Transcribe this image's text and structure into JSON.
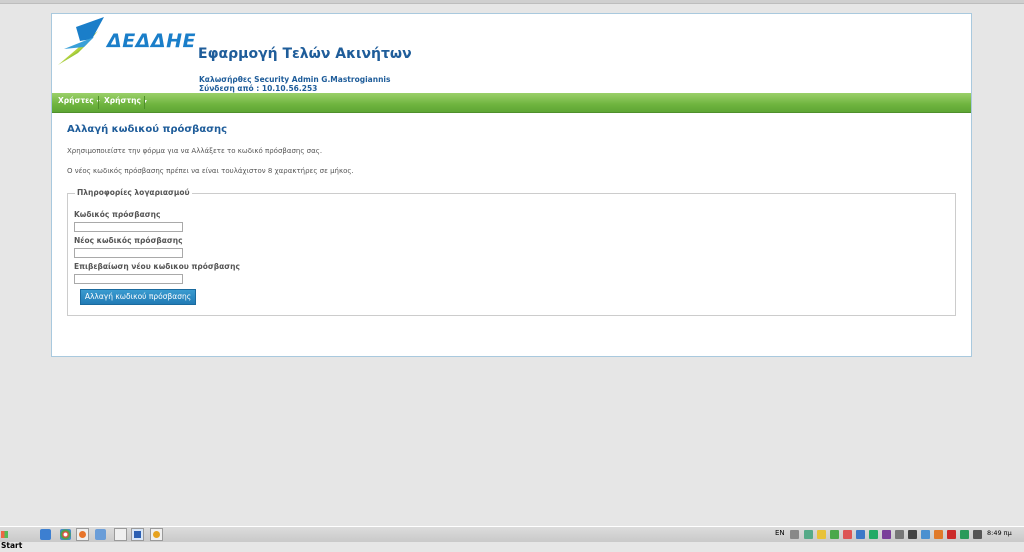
{
  "logo": {
    "text": "ΔΕΔΔΗΕ"
  },
  "header": {
    "app_title": "Εφαρμογή Τελών Ακινήτων",
    "welcome": "Καλωσήρθες Security Admin G.Mastrogiannis",
    "connection": "Σύνδεση από : 10.10.56.253"
  },
  "menu": {
    "items": [
      {
        "label": "Χρήστες",
        "icon": "caret-down-icon"
      },
      {
        "label": "Χρήστης",
        "icon": "caret-down-icon"
      }
    ]
  },
  "form": {
    "heading": "Αλλαγή κωδικού πρόσβασης",
    "info1": "Χρησιμοποιείστε την φόρμα για να Αλλάξετε το κωδικό πρόσβασης σας.",
    "info2": "Ο νέος κωδικός πρόσβασης πρέπει να είναι τουλάχιστον 8 χαρακτήρες σε μήκος.",
    "legend": "Πληροφορίες λογαριασμού",
    "fields": [
      {
        "label": "Κωδικός πρόσβασης",
        "value": ""
      },
      {
        "label": "Νέος κωδικός πρόσβασης",
        "value": ""
      },
      {
        "label": "Επιβεβαίωση νέου κωδικου πρόσβασης",
        "value": ""
      }
    ],
    "submit_label": "Αλλαγή κωδικού πρόσβασης"
  },
  "taskbar": {
    "start_label": "Start",
    "language": "EN",
    "clock": "8:49 πμ"
  },
  "colors": {
    "accent": "#1f5d9a",
    "menubar": "#6fb43f",
    "button": "#217bb5"
  }
}
